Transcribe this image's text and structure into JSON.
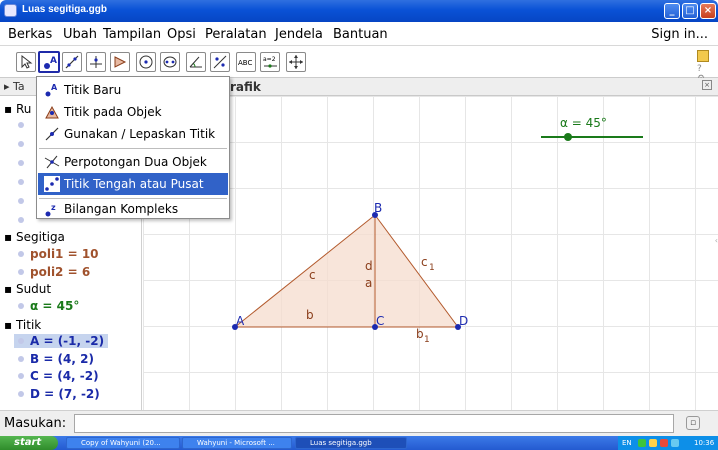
{
  "window": {
    "title": "Luas segitiga.ggb"
  },
  "menu": {
    "items": [
      "Berkas",
      "Ubah",
      "Tampilan",
      "Opsi",
      "Peralatan",
      "Jendela",
      "Bantuan"
    ],
    "sign_in": "Sign in..."
  },
  "toolbar": {
    "text_tool": "ABC",
    "slider_tool": "a=2"
  },
  "tabs": {
    "left": "Ta",
    "right": "rafik"
  },
  "dropdown": {
    "items": [
      "Titik Baru",
      "Titik pada Objek",
      "Gunakan / Lepaskan Titik",
      "Perpotongan Dua Objek",
      "Titik Tengah atau Pusat",
      "Bilangan Kompleks"
    ],
    "highlighted_index": 4
  },
  "algebra": {
    "partial_header": "Ru",
    "groups": [
      {
        "name": "Segitiga",
        "items": [
          "poli1 = 10",
          "poli2 = 6"
        ],
        "color": "#a0522d"
      },
      {
        "name": "Sudut",
        "items": [
          "α = 45°"
        ],
        "color": "#1a7a1a"
      },
      {
        "name": "Titik",
        "items": [
          "A = (-1, -2)",
          "B = (4, 2)",
          "C = (4, -2)",
          "D = (7, -2)"
        ],
        "color": "#1a2aa8",
        "selected_index": 0
      }
    ]
  },
  "graphics": {
    "slider_label": "α = 45°",
    "points": [
      "A",
      "B",
      "C",
      "D"
    ],
    "segment_labels": {
      "c": "c",
      "c1": "c",
      "c1_sub": "1",
      "d": "d",
      "a": "a",
      "b": "b",
      "b1": "b",
      "b1_sub": "1"
    },
    "colors": {
      "triangle_fill": "#f6dccd",
      "triangle_edge": "#b35a2d",
      "point": "#1c2ab0",
      "slider": "#1a7a1a"
    }
  },
  "input": {
    "label": "Masukan:",
    "value": ""
  },
  "taskbar": {
    "start": "start",
    "tasks": [
      "Copy of Wahyuni (20...",
      "Wahyuni - Microsoft ...",
      "Luas segitiga.ggb"
    ],
    "tray_lang": "EN",
    "clock": "10:36"
  }
}
